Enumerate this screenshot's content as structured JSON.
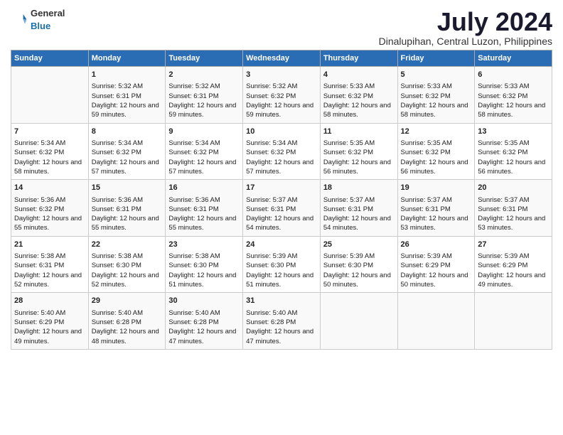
{
  "header": {
    "logo_general": "General",
    "logo_blue": "Blue",
    "title": "July 2024",
    "subtitle": "Dinalupihan, Central Luzon, Philippines"
  },
  "calendar": {
    "days_of_week": [
      "Sunday",
      "Monday",
      "Tuesday",
      "Wednesday",
      "Thursday",
      "Friday",
      "Saturday"
    ],
    "weeks": [
      [
        {
          "day": "",
          "sunrise": "",
          "sunset": "",
          "daylight": ""
        },
        {
          "day": "1",
          "sunrise": "Sunrise: 5:32 AM",
          "sunset": "Sunset: 6:31 PM",
          "daylight": "Daylight: 12 hours and 59 minutes."
        },
        {
          "day": "2",
          "sunrise": "Sunrise: 5:32 AM",
          "sunset": "Sunset: 6:31 PM",
          "daylight": "Daylight: 12 hours and 59 minutes."
        },
        {
          "day": "3",
          "sunrise": "Sunrise: 5:32 AM",
          "sunset": "Sunset: 6:32 PM",
          "daylight": "Daylight: 12 hours and 59 minutes."
        },
        {
          "day": "4",
          "sunrise": "Sunrise: 5:33 AM",
          "sunset": "Sunset: 6:32 PM",
          "daylight": "Daylight: 12 hours and 58 minutes."
        },
        {
          "day": "5",
          "sunrise": "Sunrise: 5:33 AM",
          "sunset": "Sunset: 6:32 PM",
          "daylight": "Daylight: 12 hours and 58 minutes."
        },
        {
          "day": "6",
          "sunrise": "Sunrise: 5:33 AM",
          "sunset": "Sunset: 6:32 PM",
          "daylight": "Daylight: 12 hours and 58 minutes."
        }
      ],
      [
        {
          "day": "7",
          "sunrise": "Sunrise: 5:34 AM",
          "sunset": "Sunset: 6:32 PM",
          "daylight": "Daylight: 12 hours and 58 minutes."
        },
        {
          "day": "8",
          "sunrise": "Sunrise: 5:34 AM",
          "sunset": "Sunset: 6:32 PM",
          "daylight": "Daylight: 12 hours and 57 minutes."
        },
        {
          "day": "9",
          "sunrise": "Sunrise: 5:34 AM",
          "sunset": "Sunset: 6:32 PM",
          "daylight": "Daylight: 12 hours and 57 minutes."
        },
        {
          "day": "10",
          "sunrise": "Sunrise: 5:34 AM",
          "sunset": "Sunset: 6:32 PM",
          "daylight": "Daylight: 12 hours and 57 minutes."
        },
        {
          "day": "11",
          "sunrise": "Sunrise: 5:35 AM",
          "sunset": "Sunset: 6:32 PM",
          "daylight": "Daylight: 12 hours and 56 minutes."
        },
        {
          "day": "12",
          "sunrise": "Sunrise: 5:35 AM",
          "sunset": "Sunset: 6:32 PM",
          "daylight": "Daylight: 12 hours and 56 minutes."
        },
        {
          "day": "13",
          "sunrise": "Sunrise: 5:35 AM",
          "sunset": "Sunset: 6:32 PM",
          "daylight": "Daylight: 12 hours and 56 minutes."
        }
      ],
      [
        {
          "day": "14",
          "sunrise": "Sunrise: 5:36 AM",
          "sunset": "Sunset: 6:32 PM",
          "daylight": "Daylight: 12 hours and 55 minutes."
        },
        {
          "day": "15",
          "sunrise": "Sunrise: 5:36 AM",
          "sunset": "Sunset: 6:31 PM",
          "daylight": "Daylight: 12 hours and 55 minutes."
        },
        {
          "day": "16",
          "sunrise": "Sunrise: 5:36 AM",
          "sunset": "Sunset: 6:31 PM",
          "daylight": "Daylight: 12 hours and 55 minutes."
        },
        {
          "day": "17",
          "sunrise": "Sunrise: 5:37 AM",
          "sunset": "Sunset: 6:31 PM",
          "daylight": "Daylight: 12 hours and 54 minutes."
        },
        {
          "day": "18",
          "sunrise": "Sunrise: 5:37 AM",
          "sunset": "Sunset: 6:31 PM",
          "daylight": "Daylight: 12 hours and 54 minutes."
        },
        {
          "day": "19",
          "sunrise": "Sunrise: 5:37 AM",
          "sunset": "Sunset: 6:31 PM",
          "daylight": "Daylight: 12 hours and 53 minutes."
        },
        {
          "day": "20",
          "sunrise": "Sunrise: 5:37 AM",
          "sunset": "Sunset: 6:31 PM",
          "daylight": "Daylight: 12 hours and 53 minutes."
        }
      ],
      [
        {
          "day": "21",
          "sunrise": "Sunrise: 5:38 AM",
          "sunset": "Sunset: 6:31 PM",
          "daylight": "Daylight: 12 hours and 52 minutes."
        },
        {
          "day": "22",
          "sunrise": "Sunrise: 5:38 AM",
          "sunset": "Sunset: 6:30 PM",
          "daylight": "Daylight: 12 hours and 52 minutes."
        },
        {
          "day": "23",
          "sunrise": "Sunrise: 5:38 AM",
          "sunset": "Sunset: 6:30 PM",
          "daylight": "Daylight: 12 hours and 51 minutes."
        },
        {
          "day": "24",
          "sunrise": "Sunrise: 5:39 AM",
          "sunset": "Sunset: 6:30 PM",
          "daylight": "Daylight: 12 hours and 51 minutes."
        },
        {
          "day": "25",
          "sunrise": "Sunrise: 5:39 AM",
          "sunset": "Sunset: 6:30 PM",
          "daylight": "Daylight: 12 hours and 50 minutes."
        },
        {
          "day": "26",
          "sunrise": "Sunrise: 5:39 AM",
          "sunset": "Sunset: 6:29 PM",
          "daylight": "Daylight: 12 hours and 50 minutes."
        },
        {
          "day": "27",
          "sunrise": "Sunrise: 5:39 AM",
          "sunset": "Sunset: 6:29 PM",
          "daylight": "Daylight: 12 hours and 49 minutes."
        }
      ],
      [
        {
          "day": "28",
          "sunrise": "Sunrise: 5:40 AM",
          "sunset": "Sunset: 6:29 PM",
          "daylight": "Daylight: 12 hours and 49 minutes."
        },
        {
          "day": "29",
          "sunrise": "Sunrise: 5:40 AM",
          "sunset": "Sunset: 6:28 PM",
          "daylight": "Daylight: 12 hours and 48 minutes."
        },
        {
          "day": "30",
          "sunrise": "Sunrise: 5:40 AM",
          "sunset": "Sunset: 6:28 PM",
          "daylight": "Daylight: 12 hours and 47 minutes."
        },
        {
          "day": "31",
          "sunrise": "Sunrise: 5:40 AM",
          "sunset": "Sunset: 6:28 PM",
          "daylight": "Daylight: 12 hours and 47 minutes."
        },
        {
          "day": "",
          "sunrise": "",
          "sunset": "",
          "daylight": ""
        },
        {
          "day": "",
          "sunrise": "",
          "sunset": "",
          "daylight": ""
        },
        {
          "day": "",
          "sunrise": "",
          "sunset": "",
          "daylight": ""
        }
      ]
    ]
  }
}
